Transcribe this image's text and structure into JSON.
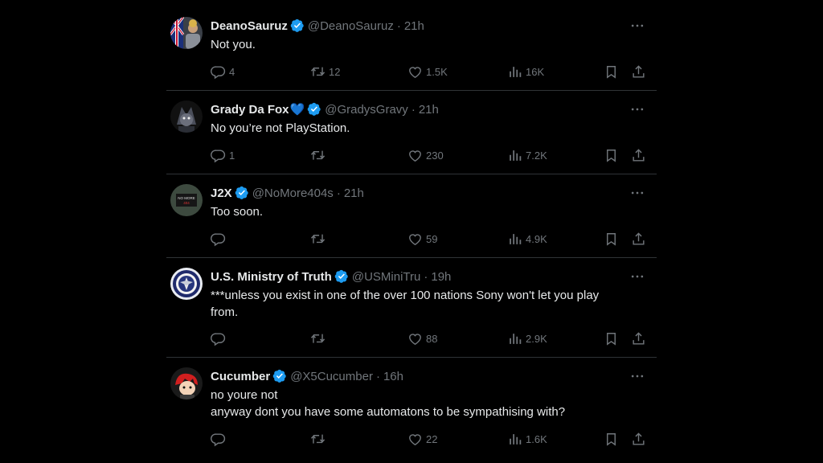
{
  "tweets": [
    {
      "name": "DeanoSauruz",
      "handle": "@DeanoSauruz",
      "time": "21h",
      "lines": [
        "Not you."
      ],
      "replies": "4",
      "retweets": "12",
      "likes": "1.5K",
      "views": "16K"
    },
    {
      "name": "Grady Da Fox",
      "emoji": "💙",
      "handle": "@GradysGravy",
      "time": "21h",
      "lines": [
        "No you’re not PlayStation."
      ],
      "replies": "1",
      "retweets": "",
      "likes": "230",
      "views": "7.2K"
    },
    {
      "name": "J2X",
      "handle": "@NoMore404s",
      "time": "21h",
      "lines": [
        "Too soon."
      ],
      "replies": "",
      "retweets": "",
      "likes": "59",
      "views": "4.9K"
    },
    {
      "name": "U.S. Ministry of Truth",
      "handle": "@USMiniTru",
      "time": "19h",
      "lines": [
        "***unless you exist in one of the over 100 nations Sony won't let you play",
        "from."
      ],
      "replies": "",
      "retweets": "",
      "likes": "88",
      "views": "2.9K"
    },
    {
      "name": "Cucumber",
      "handle": "@X5Cucumber",
      "time": "16h",
      "lines": [
        "no youre not",
        "anyway dont you have some automatons to be sympathising with?"
      ],
      "replies": "",
      "retweets": "",
      "likes": "22",
      "views": "1.6K"
    }
  ],
  "sep": "·",
  "icons": {
    "reply": "reply-icon",
    "retweet": "retweet-icon",
    "like": "like-icon",
    "views": "views-icon",
    "bookmark": "bookmark-icon",
    "share": "share-icon",
    "more": "more-icon",
    "verified": "verified-badge-icon"
  },
  "colors": {
    "background": "#000000",
    "text": "#e7e9ea",
    "muted": "#71767b",
    "verified": "#1d9bf0",
    "divider": "#2f3336"
  }
}
